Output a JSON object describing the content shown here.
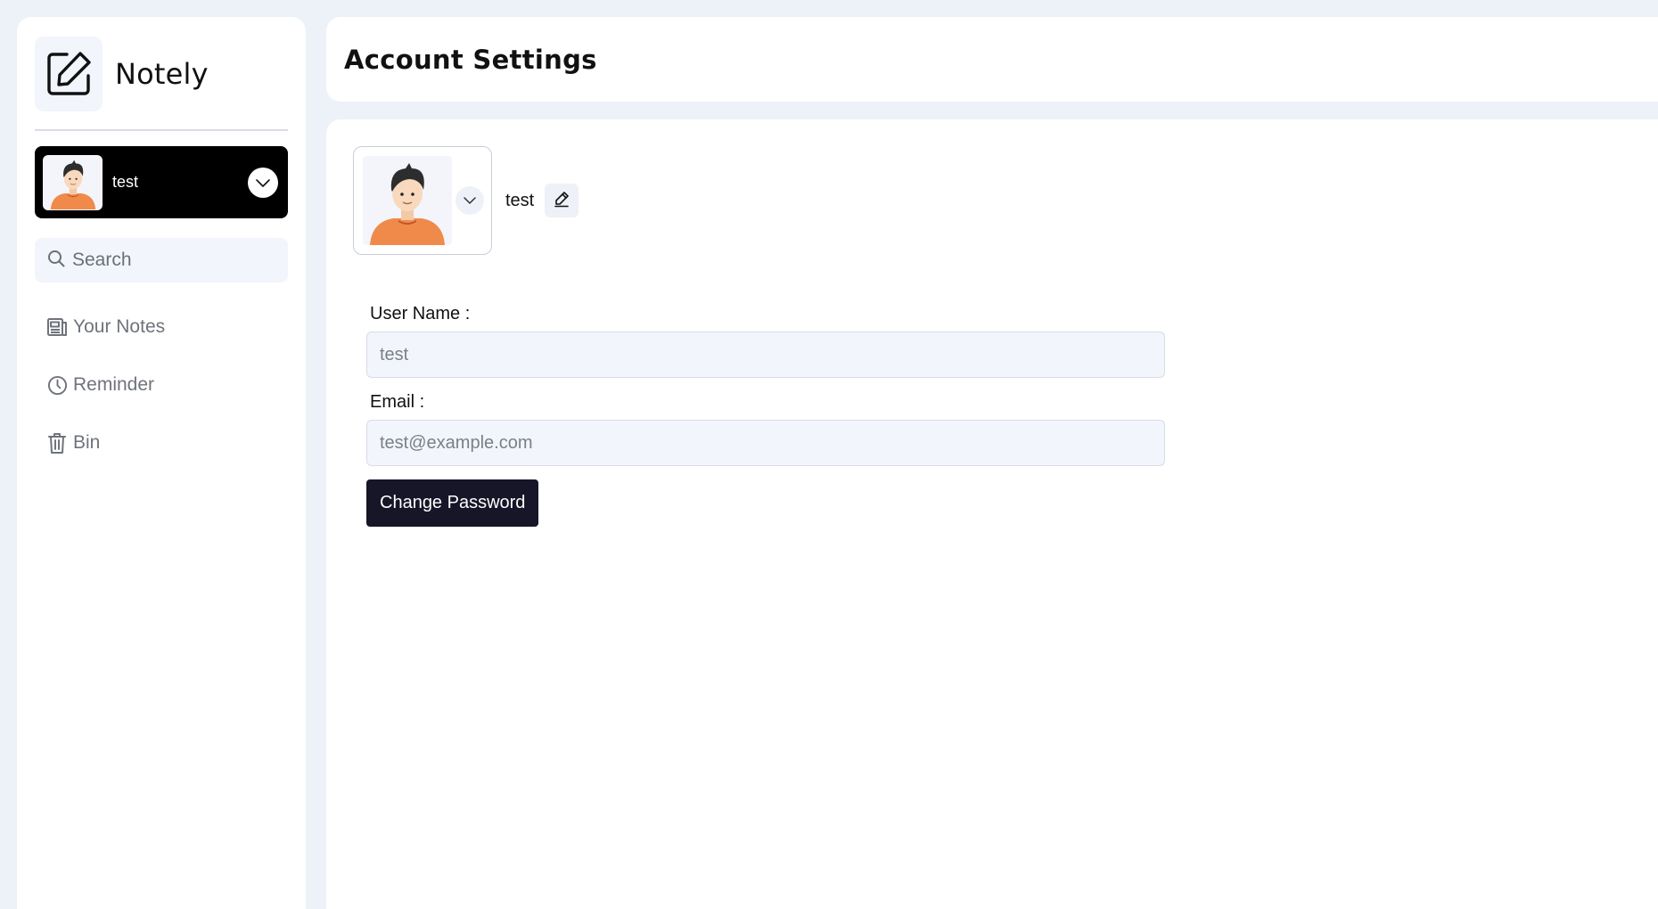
{
  "app": {
    "name": "Notely",
    "logo_icon": "edit-square-icon"
  },
  "user_card": {
    "name": "test",
    "avatar_icon": "user-avatar-icon",
    "chevron_icon": "chevron-down-icon"
  },
  "search": {
    "placeholder": "Search",
    "icon": "search-icon"
  },
  "nav": {
    "items": [
      {
        "label": "Your Notes",
        "icon": "notes-icon"
      },
      {
        "label": "Reminder",
        "icon": "clock-icon"
      },
      {
        "label": "Bin",
        "icon": "trash-icon"
      }
    ]
  },
  "header": {
    "title": "Account Settings"
  },
  "profile": {
    "name": "test",
    "edit_icon": "pencil-icon",
    "chevron_icon": "chevron-down-icon"
  },
  "form": {
    "username_label": "User Name :",
    "username_placeholder": "test",
    "email_label": "Email :",
    "email_placeholder": "test@example.com",
    "change_password_label": "Change Password"
  },
  "colors": {
    "background": "#edf1f8",
    "user_card": "#000000",
    "input_bg": "#f2f5fc",
    "primary_button": "#161628",
    "avatar_shirt": "#f08a4b"
  }
}
